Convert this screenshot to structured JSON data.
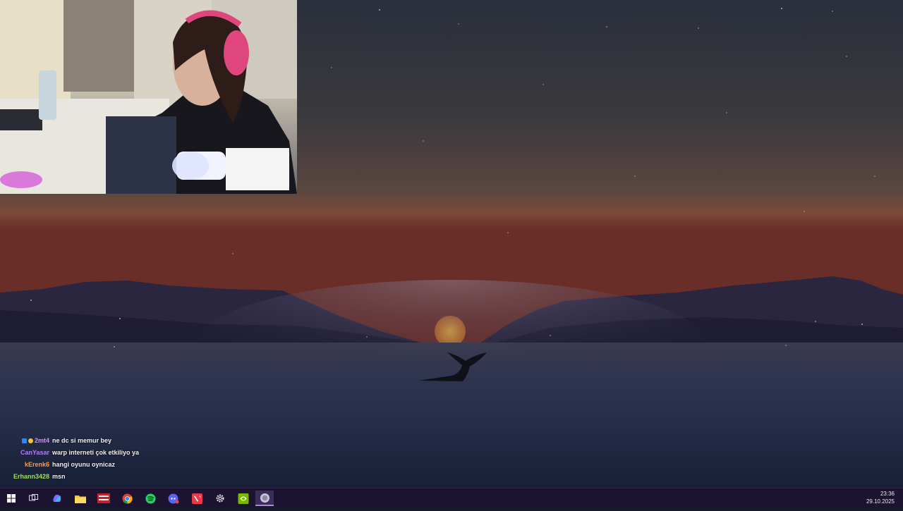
{
  "chat": [
    {
      "user": "2mt4",
      "color": "#d18cff",
      "badges": true,
      "message": "ne dc si memur bey"
    },
    {
      "user": "CanYasar",
      "color": "#b27bff",
      "badges": false,
      "message": "warp interneti çok etkiliyo ya"
    },
    {
      "user": "kErenk6",
      "color": "#ff9b3d",
      "badges": false,
      "message": "hangi oyunu oynicaz"
    },
    {
      "user": "Erhann3428",
      "color": "#9be05a",
      "badges": false,
      "message": "msn"
    }
  ],
  "taskbar": {
    "apps": [
      {
        "name": "start-icon"
      },
      {
        "name": "task-view-icon"
      },
      {
        "name": "copilot-icon"
      },
      {
        "name": "file-explorer-icon"
      },
      {
        "name": "voice-meeter-icon",
        "label": "VOICE METER"
      },
      {
        "name": "chrome-icon"
      },
      {
        "name": "spotify-icon"
      },
      {
        "name": "discord-icon"
      },
      {
        "name": "valorant-icon"
      },
      {
        "name": "settings-icon"
      },
      {
        "name": "nvidia-icon"
      },
      {
        "name": "obs-app-icon"
      }
    ],
    "time": "23:36",
    "date": "29.10.2025"
  },
  "colors": {
    "taskbar": "#1b1330",
    "sky_top": "#2b3040",
    "horizon": "#7a3f30",
    "water": "#1c2c4a"
  }
}
